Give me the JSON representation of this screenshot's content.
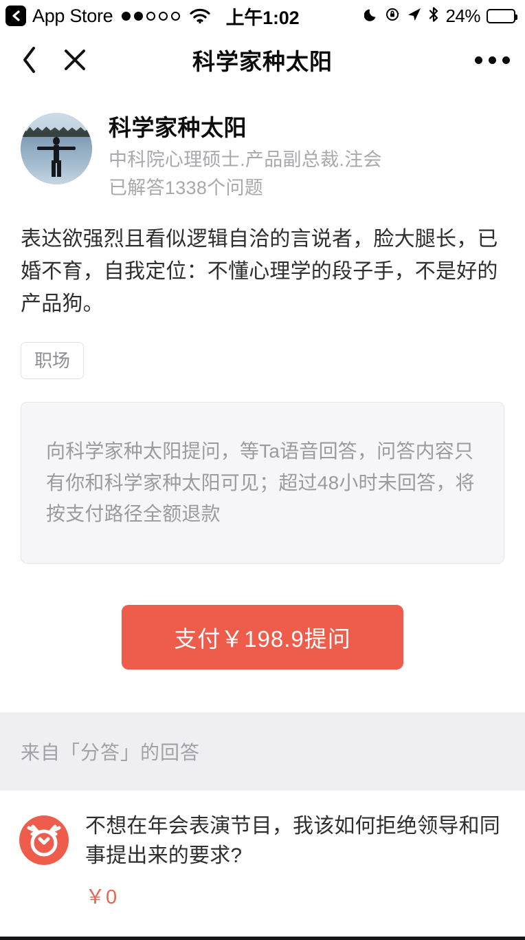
{
  "status_bar": {
    "back_app_label": "App Store",
    "back_icon": "back-chevron-icon",
    "signal_dots_filled": 2,
    "signal_dots_total": 5,
    "wifi_icon": "wifi-icon",
    "time": "上午1:02",
    "dnd_icon": "moon-icon",
    "rotation_lock_icon": "rotation-lock-icon",
    "location_icon": "location-arrow-icon",
    "bluetooth_icon": "bluetooth-icon",
    "battery_percent_label": "24%",
    "battery_level": 24
  },
  "nav_bar": {
    "back_icon": "chevron-left-icon",
    "close_icon": "close-icon",
    "title": "科学家种太阳",
    "more_icon": "more-horizontal-icon"
  },
  "profile": {
    "avatar_alt": "lake-silhouette-avatar",
    "name": "科学家种太阳",
    "subtitle": "中科院心理硕士.产品副总裁.注会",
    "answered_count_label": "已解答1338个问题",
    "bio": "表达欲强烈且看似逻辑自洽的言说者，脸大腿长，已婚不育，自我定位：不懂心理学的段子手，不是好的产品狗。",
    "tags": [
      "职场"
    ]
  },
  "ask_box": {
    "hint": "向科学家种太阳提问，等Ta语音回答，问答内容只有你和科学家种太阳可见；超过48小时未回答，将按支付路径全额退款"
  },
  "pay": {
    "button_label": "支付￥198.9提问",
    "price": "198.9",
    "currency": "￥",
    "accent_color": "#ee5d4c"
  },
  "answers_section": {
    "header": "来自「分答」的回答",
    "items": [
      {
        "avatar_icon": "fenda-logo-icon",
        "question": "不想在年会表演节目，我该如何拒绝领导和同事提出来的要求?",
        "price_label": "￥0"
      }
    ]
  },
  "colors": {
    "accent": "#ee5d4c",
    "section_band": "#eeeef3",
    "muted_text": "#a8a8ad",
    "body_text": "#2e2e2e"
  }
}
